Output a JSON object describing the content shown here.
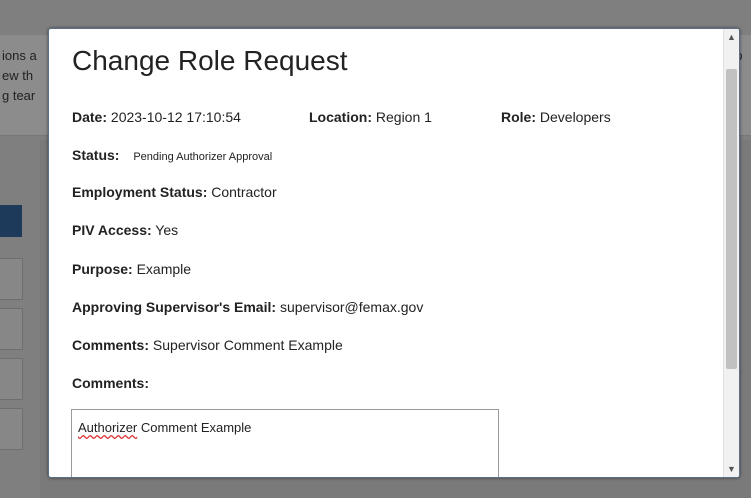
{
  "background": {
    "left_lines": [
      "ions a",
      "ew th",
      "g tear"
    ],
    "right_lines": [
      ", p",
      "io",
      ""
    ]
  },
  "modal": {
    "title": "Change Role Request",
    "date_label": "Date:",
    "date_value": "2023-10-12 17:10:54",
    "location_label": "Location:",
    "location_value": "Region 1",
    "role_label": "Role:",
    "role_value": "Developers",
    "status_label": "Status:",
    "status_value": "Pending Authorizer Approval",
    "employment_label": "Employment Status:",
    "employment_value": "Contractor",
    "piv_label": "PIV Access:",
    "piv_value": "Yes",
    "purpose_label": "Purpose:",
    "purpose_value": "Example",
    "supervisor_email_label": "Approving Supervisor's Email:",
    "supervisor_email_value": "supervisor@femax.gov",
    "comments_label": "Comments:",
    "comments_value": "Supervisor Comment Example",
    "comments2_label": "Comments:",
    "authorizer_comment_word1": "Authorizer",
    "authorizer_comment_rest": " Comment Example"
  },
  "scrollbar": {
    "up_icon": "▲",
    "down_icon": "▼"
  }
}
